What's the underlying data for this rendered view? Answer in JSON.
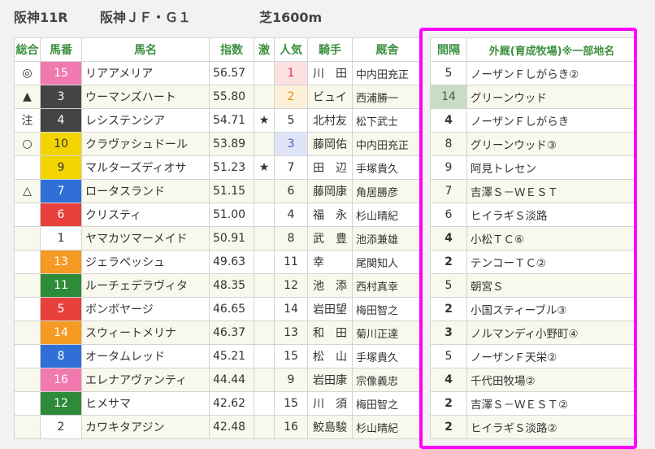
{
  "header": {
    "race": "阪神11R",
    "name": "阪神ＪＦ・Ｇ１",
    "course": "芝1600m"
  },
  "columns": {
    "sogo": "総合",
    "umaban": "馬番",
    "bamei": "馬名",
    "shisu": "指数",
    "geki": "激",
    "ninki": "人気",
    "kishu": "騎手",
    "kyusha": "厩舎",
    "kankaku": "間隔",
    "gaikyu": "外厩(育成牧場)※一部地名"
  },
  "colors": {
    "highlight_border": "#ff00ff",
    "header_text": "#3d9140"
  },
  "rows": [
    {
      "sogo": "◎",
      "umaban": "15",
      "bamei": "リアアメリア",
      "shisu": "56.57",
      "geki": "",
      "ninki": "1",
      "kishu": "川　田",
      "kyusha": "中内田充正",
      "kankaku": "5",
      "gaikyu": "ノーザンＦしがらき②"
    },
    {
      "sogo": "▲",
      "umaban": "3",
      "bamei": "ウーマンズハート",
      "shisu": "55.80",
      "geki": "",
      "ninki": "2",
      "kishu": "ビュイ",
      "kyusha": "西浦勝一",
      "kankaku": "14",
      "gaikyu": "グリーンウッド"
    },
    {
      "sogo": "注",
      "umaban": "4",
      "bamei": "レシステンシア",
      "shisu": "54.71",
      "geki": "★",
      "ninki": "5",
      "kishu": "北村友",
      "kyusha": "松下武士",
      "kankaku": "4",
      "gaikyu": "ノーザンＦしがらき"
    },
    {
      "sogo": "○",
      "umaban": "10",
      "bamei": "クラヴァシュドール",
      "shisu": "53.89",
      "geki": "",
      "ninki": "3",
      "kishu": "藤岡佑",
      "kyusha": "中内田充正",
      "kankaku": "8",
      "gaikyu": "グリーンウッド③"
    },
    {
      "sogo": "",
      "umaban": "9",
      "bamei": "マルターズディオサ",
      "shisu": "51.23",
      "geki": "★",
      "ninki": "7",
      "kishu": "田　辺",
      "kyusha": "手塚貴久",
      "kankaku": "9",
      "gaikyu": "阿見トレセン"
    },
    {
      "sogo": "△",
      "umaban": "7",
      "bamei": "ロータスランド",
      "shisu": "51.15",
      "geki": "",
      "ninki": "6",
      "kishu": "藤岡康",
      "kyusha": "角居勝彦",
      "kankaku": "7",
      "gaikyu": "吉澤Ｓ－ＷＥＳＴ"
    },
    {
      "sogo": "",
      "umaban": "6",
      "bamei": "クリスティ",
      "shisu": "51.00",
      "geki": "",
      "ninki": "4",
      "kishu": "福　永",
      "kyusha": "杉山晴紀",
      "kankaku": "6",
      "gaikyu": "ヒイラギＳ淡路"
    },
    {
      "sogo": "",
      "umaban": "1",
      "bamei": "ヤマカツマーメイド",
      "shisu": "50.91",
      "geki": "",
      "ninki": "8",
      "kishu": "武　豊",
      "kyusha": "池添兼雄",
      "kankaku": "4",
      "gaikyu": "小松ＴＣ⑥"
    },
    {
      "sogo": "",
      "umaban": "13",
      "bamei": "ジェラペッシュ",
      "shisu": "49.63",
      "geki": "",
      "ninki": "11",
      "kishu": "幸",
      "kyusha": "尾関知人",
      "kankaku": "2",
      "gaikyu": "テンコーＴＣ②"
    },
    {
      "sogo": "",
      "umaban": "11",
      "bamei": "ルーチェデラヴィタ",
      "shisu": "48.35",
      "geki": "",
      "ninki": "12",
      "kishu": "池　添",
      "kyusha": "西村真幸",
      "kankaku": "5",
      "gaikyu": "朝宮Ｓ"
    },
    {
      "sogo": "",
      "umaban": "5",
      "bamei": "ボンボヤージ",
      "shisu": "46.65",
      "geki": "",
      "ninki": "14",
      "kishu": "岩田望",
      "kyusha": "梅田智之",
      "kankaku": "2",
      "gaikyu": "小国スティーブル③"
    },
    {
      "sogo": "",
      "umaban": "14",
      "bamei": "スウィートメリナ",
      "shisu": "46.37",
      "geki": "",
      "ninki": "13",
      "kishu": "和　田",
      "kyusha": "菊川正達",
      "kankaku": "3",
      "gaikyu": "ノルマンディ小野町④"
    },
    {
      "sogo": "",
      "umaban": "8",
      "bamei": "オータムレッド",
      "shisu": "45.21",
      "geki": "",
      "ninki": "15",
      "kishu": "松　山",
      "kyusha": "手塚貴久",
      "kankaku": "5",
      "gaikyu": "ノーザンＦ天栄②"
    },
    {
      "sogo": "",
      "umaban": "16",
      "bamei": "エレナアヴァンティ",
      "shisu": "44.44",
      "geki": "",
      "ninki": "9",
      "kishu": "岩田康",
      "kyusha": "宗像義忠",
      "kankaku": "4",
      "gaikyu": "千代田牧場②"
    },
    {
      "sogo": "",
      "umaban": "12",
      "bamei": "ヒメサマ",
      "shisu": "42.62",
      "geki": "",
      "ninki": "15",
      "kishu": "川　須",
      "kyusha": "梅田智之",
      "kankaku": "2",
      "gaikyu": "吉澤Ｓ－ＷＥＳＴ②"
    },
    {
      "sogo": "",
      "umaban": "2",
      "bamei": "カワキタアジン",
      "shisu": "42.48",
      "geki": "",
      "ninki": "16",
      "kishu": "鮫島駿",
      "kyusha": "杉山晴紀",
      "kankaku": "2",
      "gaikyu": "ヒイラギＳ淡路②"
    }
  ]
}
